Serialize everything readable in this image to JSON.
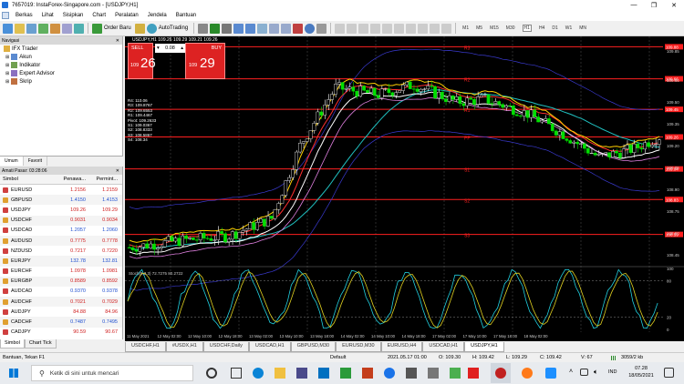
{
  "window": {
    "title": "7657019: InstaForex-Singapore.com - [USDJPY,H1]",
    "min": "—",
    "max": "❐",
    "close": "✕"
  },
  "menu": [
    "Berkas",
    "Lihat",
    "Sisipkan",
    "Chart",
    "Peralatan",
    "Jendela",
    "Bantuan"
  ],
  "toolbar": {
    "new_order": "Order Baru",
    "autotrading": "AutoTrading",
    "timeframes": [
      "M1",
      "M5",
      "M15",
      "M30",
      "H1",
      "H4",
      "D1",
      "W1",
      "MN"
    ]
  },
  "navigator": {
    "title": "Navigasi",
    "items": [
      "IFX Trader",
      "Akun",
      "Indikator",
      "Expert Advisor",
      "Skrip"
    ],
    "tabs": [
      "Umum",
      "Favorit"
    ]
  },
  "market": {
    "title": "Amati Pasar: 03:28:06",
    "cols": [
      "Simbol",
      "Penawa...",
      "Permint..."
    ],
    "rows": [
      [
        "EURUSD",
        "1.2156",
        "1.2159"
      ],
      [
        "GBPUSD",
        "1.4150",
        "1.4153"
      ],
      [
        "USDJPY",
        "109.26",
        "109.29"
      ],
      [
        "USDCHF",
        "0.9031",
        "0.9034"
      ],
      [
        "USDCAD",
        "1.2057",
        "1.2060"
      ],
      [
        "AUDUSD",
        "0.7775",
        "0.7778"
      ],
      [
        "NZDUSD",
        "0.7217",
        "0.7220"
      ],
      [
        "EURJPY",
        "132.78",
        "132.81"
      ],
      [
        "EURCHF",
        "1.0978",
        "1.0981"
      ],
      [
        "EURGBP",
        "0.8589",
        "0.8592"
      ],
      [
        "AUDCAD",
        "0.9370",
        "0.9378"
      ],
      [
        "AUDCHF",
        "0.7021",
        "0.7029"
      ],
      [
        "AUDJPY",
        "84.88",
        "84.96"
      ],
      [
        "CADCHF",
        "0.7487",
        "0.7495"
      ],
      [
        "CADJPY",
        "90.59",
        "90.67"
      ]
    ],
    "tabs": [
      "Simbol",
      "Chart Tick"
    ]
  },
  "chart": {
    "symbol_label": "USDJPY,H1  109.26 109.29 109.21 109.26",
    "sell": "SELL",
    "buy": "BUY",
    "lot": "0.08",
    "sell_price_small": "109",
    "sell_price_big": "26",
    "buy_price_small": "109",
    "buy_price_big": "29",
    "pivots": [
      "R4: 110.06",
      "R3: 109.8767",
      "R2: 109.6553",
      "R1: 109.4467",
      "Pivot: 109.2633",
      "S1: 109.0367",
      "S2: 108.8333",
      "S3: 108.5867",
      "S4: 108.34"
    ],
    "levels": [
      {
        "name": "R3",
        "price": "109.88"
      },
      {
        "name": "R2",
        "price": "109.66"
      },
      {
        "name": "R1",
        "price": "109.45"
      },
      {
        "name": "PP",
        "price": "109.26"
      },
      {
        "name": "S1",
        "price": "109.04"
      },
      {
        "name": "S2",
        "price": "108.83"
      },
      {
        "name": "S3",
        "price": "108.59"
      }
    ],
    "yticks": [
      "109.85",
      "109.65",
      "109.50",
      "109.35",
      "109.20",
      "109.05",
      "108.90",
      "108.75",
      "108.60",
      "108.45"
    ],
    "xticks": [
      "11 May 2021",
      "12 May 02:00",
      "12 May 10:00",
      "12 May 18:00",
      "13 May 02:00",
      "13 May 10:00",
      "13 May 18:00",
      "14 May 02:00",
      "14 May 10:00",
      "14 May 18:00",
      "17 May 02:00",
      "17 May 10:00",
      "17 May 18:00",
      "18 May 02:00"
    ],
    "stoch_label": "Stoch(5,3,3) 72.7275 80.2722",
    "stoch_yticks": [
      "100",
      "80",
      "20",
      "0"
    ],
    "colors": {
      "bg": "#000000",
      "level": "#ff2020",
      "bull": "#ffffff",
      "bear": "#00e000"
    }
  },
  "chart_tabs": [
    "USDCHF,H1",
    "#USDX,H1",
    "USDCHF,Daily",
    "USDCAD,H1",
    "GBPUSD,M30",
    "EURUSD,M30",
    "EURUSD,H4",
    "USDCAD,H1",
    "USDJPY,H1"
  ],
  "status": {
    "help": "Bantuan, Tekan F1",
    "profile": "Default",
    "time": "2021.05.17 01:00",
    "open": "O: 109.30",
    "high": "H: 109.42",
    "low": "L: 109.29",
    "close": "C: 109.42",
    "volume": "V: 67",
    "traffic": "3059/2 kb"
  },
  "taskbar": {
    "search": "Ketik di sini untuk mencari",
    "lang": "IND",
    "time": "07.28",
    "date": "18/05/2021"
  }
}
